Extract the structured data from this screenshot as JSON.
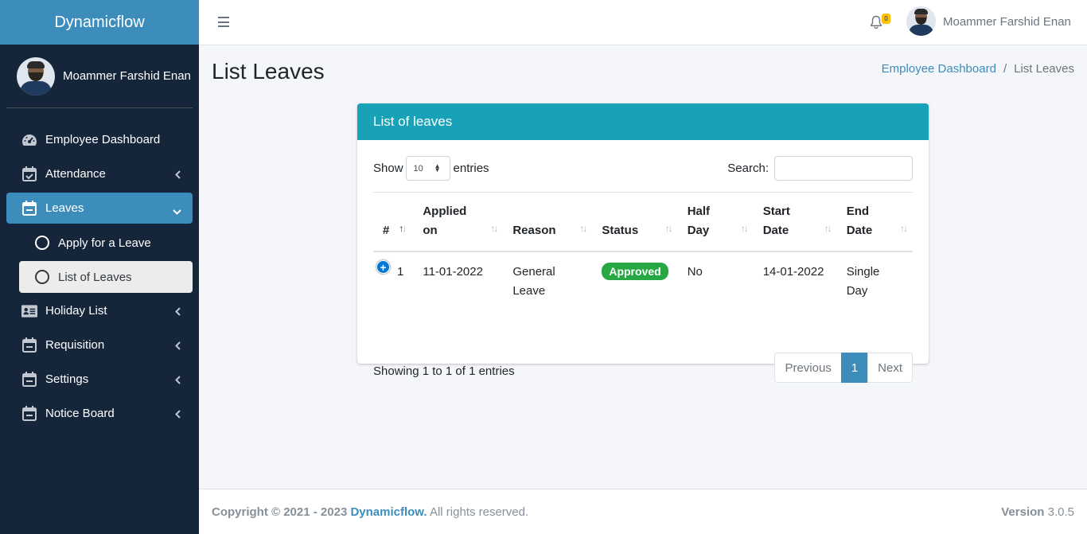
{
  "brand": {
    "name": "Dynamicflow"
  },
  "user": {
    "name": "Moammer Farshid Enan"
  },
  "sidebar": {
    "items": [
      {
        "label": "Employee Dashboard",
        "icon": "tachometer-icon"
      },
      {
        "label": "Attendance",
        "icon": "calendar-check-icon"
      },
      {
        "label": "Leaves",
        "icon": "calendar-minus-icon"
      },
      {
        "label": "Holiday List",
        "icon": "id-card-icon"
      },
      {
        "label": "Requisition",
        "icon": "calendar-minus-icon"
      },
      {
        "label": "Settings",
        "icon": "calendar-minus-icon"
      },
      {
        "label": "Notice Board",
        "icon": "calendar-minus-icon"
      }
    ],
    "sub_items": [
      {
        "label": "Apply for a Leave"
      },
      {
        "label": "List of Leaves"
      }
    ]
  },
  "topbar": {
    "notification_count": "0",
    "user_name": "Moammer Farshid Enan"
  },
  "page": {
    "title": "List Leaves",
    "breadcrumb": {
      "home": "Employee Dashboard",
      "current": "List Leaves",
      "separator": "/"
    }
  },
  "card": {
    "title": "List of leaves",
    "show_label": "Show",
    "entries_label": "entries",
    "page_length": "10",
    "search_label": "Search:",
    "search_value": ""
  },
  "table": {
    "columns": [
      {
        "line1": "#",
        "line2": ""
      },
      {
        "line1": "Applied",
        "line2": "on"
      },
      {
        "line1": "",
        "line2": "Reason"
      },
      {
        "line1": "",
        "line2": "Status"
      },
      {
        "line1": "Half",
        "line2": "Day"
      },
      {
        "line1": "Start",
        "line2": "Date"
      },
      {
        "line1": "End",
        "line2": "Date"
      }
    ],
    "rows": [
      {
        "num": "1",
        "applied_on": "11-01-2022",
        "reason_line1": "General",
        "reason_line2": "Leave",
        "status": "Approved",
        "half_day": "No",
        "start_date": "14-01-2022",
        "end_date": "Single Day"
      }
    ]
  },
  "pagination": {
    "info": "Showing 1 to 1 of 1 entries",
    "previous": "Previous",
    "current": "1",
    "next": "Next"
  },
  "footer": {
    "copyright_prefix": "Copyright © 2021 - 2023",
    "brand": "Dynamicflow.",
    "rights": "All rights reserved.",
    "version_label": "Version",
    "version": "3.0.5"
  },
  "colors": {
    "sidebar": "#15263b",
    "brand": "#3c8dbc",
    "card_header": "#17a2b8",
    "badge_approved": "#28a745",
    "notification_badge": "#ffc107"
  }
}
